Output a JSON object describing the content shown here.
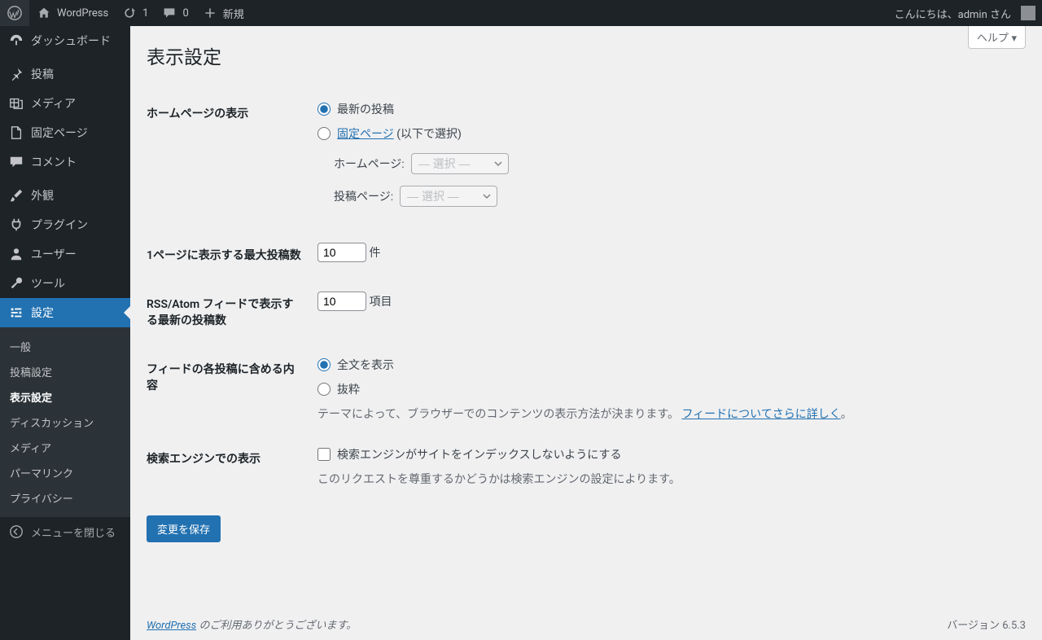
{
  "adminbar": {
    "site_name": "WordPress",
    "updates": "1",
    "comments": "0",
    "new": "新規",
    "greeting": "こんにちは、admin さん"
  },
  "sidebar": {
    "items": [
      {
        "label": "ダッシュボード"
      },
      {
        "label": "投稿"
      },
      {
        "label": "メディア"
      },
      {
        "label": "固定ページ"
      },
      {
        "label": "コメント"
      },
      {
        "label": "外観"
      },
      {
        "label": "プラグイン"
      },
      {
        "label": "ユーザー"
      },
      {
        "label": "ツール"
      },
      {
        "label": "設定"
      }
    ],
    "submenu": [
      {
        "label": "一般"
      },
      {
        "label": "投稿設定"
      },
      {
        "label": "表示設定"
      },
      {
        "label": "ディスカッション"
      },
      {
        "label": "メディア"
      },
      {
        "label": "パーマリンク"
      },
      {
        "label": "プライバシー"
      }
    ],
    "collapse": "メニューを閉じる"
  },
  "page": {
    "help": "ヘルプ",
    "title": "表示設定",
    "homepage": {
      "label": "ホームページの表示",
      "opt_latest": "最新の投稿",
      "opt_static_link": "固定ページ",
      "opt_static_suffix": " (以下で選択)",
      "home_label": "ホームページ:",
      "posts_label": "投稿ページ:",
      "select_placeholder": "— 選択 —"
    },
    "posts_per_page": {
      "label": "1ページに表示する最大投稿数",
      "value": "10",
      "unit": "件"
    },
    "rss_items": {
      "label": "RSS/Atom フィードで表示する最新の投稿数",
      "value": "10",
      "unit": "項目"
    },
    "feed_content": {
      "label": "フィードの各投稿に含める内容",
      "opt_full": "全文を表示",
      "opt_excerpt": "抜粋",
      "desc_prefix": "テーマによって、ブラウザーでのコンテンツの表示方法が決まります。",
      "desc_link": "フィードについてさらに詳しく",
      "desc_suffix": "。"
    },
    "search": {
      "label": "検索エンジンでの表示",
      "checkbox": "検索エンジンがサイトをインデックスしないようにする",
      "desc": "このリクエストを尊重するかどうかは検索エンジンの設定によります。"
    },
    "submit": "変更を保存"
  },
  "footer": {
    "link": "WordPress",
    "thanks": " のご利用ありがとうございます。",
    "version": "バージョン 6.5.3"
  }
}
